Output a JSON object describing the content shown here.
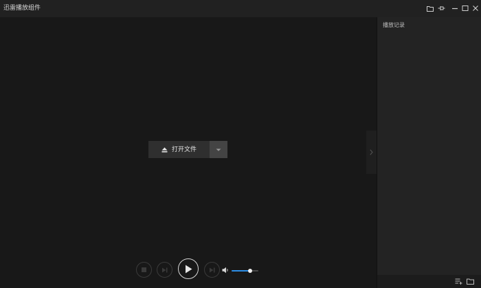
{
  "window": {
    "title": "迅雷播放组件"
  },
  "titlebar_buttons": [
    {
      "name": "folder-icon"
    },
    {
      "name": "pin-icon"
    },
    {
      "name": "minimize-icon"
    },
    {
      "name": "maximize-icon"
    },
    {
      "name": "close-icon"
    }
  ],
  "main": {
    "open_file_label": "打开文件",
    "open_file_icon": "eject-icon",
    "dropdown_icon": "caret-down-icon",
    "panel_toggle_icon": "chevron-right-icon"
  },
  "controls": {
    "buttons": [
      "stop-icon",
      "previous-icon",
      "play-icon",
      "next-icon"
    ],
    "volume_icon": "speaker-icon",
    "volume_level": 0.68,
    "accent_color": "#2d8fe8"
  },
  "sidepanel": {
    "title": "播放记录",
    "footer_icons": [
      "playlist-icon",
      "folder-icon"
    ]
  }
}
